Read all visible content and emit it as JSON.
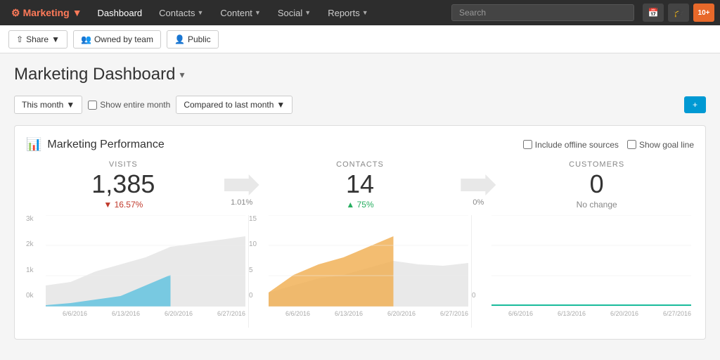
{
  "topNav": {
    "brand": "Marketing",
    "items": [
      {
        "label": "Dashboard",
        "hasDropdown": false
      },
      {
        "label": "Contacts",
        "hasDropdown": true
      },
      {
        "label": "Content",
        "hasDropdown": true
      },
      {
        "label": "Social",
        "hasDropdown": true
      },
      {
        "label": "Reports",
        "hasDropdown": true
      }
    ],
    "search": {
      "placeholder": "Search"
    },
    "icons": [
      {
        "name": "calendar-icon",
        "symbol": "31",
        "type": "calendar"
      },
      {
        "name": "academy-icon",
        "symbol": "🎓",
        "type": "academy"
      },
      {
        "name": "notifications-icon",
        "symbol": "10+",
        "type": "orange"
      }
    ]
  },
  "subNav": {
    "buttons": [
      {
        "label": "Share",
        "icon": "share-icon",
        "hasDropdown": true
      },
      {
        "label": "Owned by team",
        "icon": "team-icon",
        "hasDropdown": false
      },
      {
        "label": "Public",
        "icon": "public-icon",
        "hasDropdown": false
      }
    ]
  },
  "page": {
    "title": "Marketing Dashboard",
    "titleDropdown": true
  },
  "filters": {
    "thisMonth": "This month",
    "showEntireMonth": "Show entire month",
    "comparedTo": "Compared to last month",
    "addButton": "+"
  },
  "card": {
    "title": "Marketing Performance",
    "options": {
      "includeOffline": "Include offline sources",
      "showGoalLine": "Show goal line"
    },
    "metrics": [
      {
        "label": "VISITS",
        "value": "1,385",
        "change": "▼ 16.57%",
        "changeType": "down"
      },
      {
        "arrowLabel": "1.01%"
      },
      {
        "label": "CONTACTS",
        "value": "14",
        "change": "▲ 75%",
        "changeType": "up"
      },
      {
        "arrowLabel": "0%"
      },
      {
        "label": "CUSTOMERS",
        "value": "0",
        "change": "No change",
        "changeType": "neutral"
      }
    ],
    "charts": [
      {
        "yLabels": [
          "3k",
          "2k",
          "1k",
          "0k"
        ],
        "xLabels": [
          "6/6/2016",
          "6/13/2016",
          "6/20/2016",
          "6/27/2016"
        ],
        "color": "#5bc0de",
        "type": "visits"
      },
      {
        "yLabels": [
          "15",
          "10",
          "5",
          "0"
        ],
        "xLabels": [
          "6/6/2016",
          "6/13/2016",
          "6/20/2016",
          "6/27/2016"
        ],
        "color": "#f0ad4e",
        "type": "contacts"
      },
      {
        "yLabels": [
          "",
          "",
          "",
          "0"
        ],
        "xLabels": [
          "6/6/2016",
          "6/13/2016",
          "6/20/2016",
          "6/27/2016"
        ],
        "color": "#1abc9c",
        "type": "customers"
      }
    ]
  }
}
